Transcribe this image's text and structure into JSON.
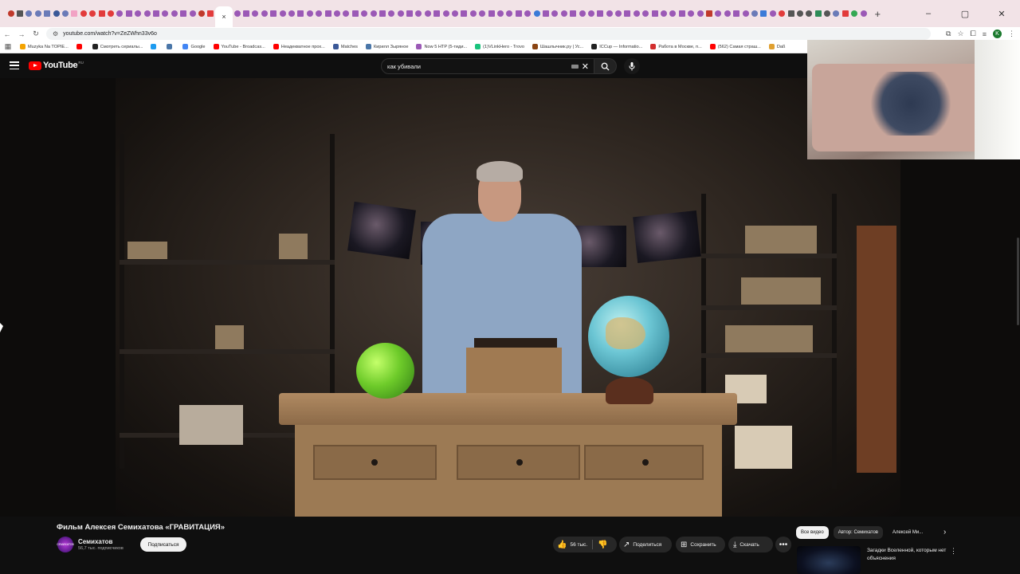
{
  "browser": {
    "tab_favicons": [
      "#c0392b",
      "#555555",
      "#6b7bb8",
      "#6b7bb8",
      "#6b7bb8",
      "#3b5998",
      "#6b7bb8",
      "#f2a2c4",
      "#e23b3b",
      "#e23b3b",
      "#e23b3b",
      "#e23b3b",
      "#9b59b6",
      "#9b59b6",
      "#9b59b6",
      "#9b59b6",
      "#9b59b6",
      "#9b59b6",
      "#9b59b6",
      "#9b59b6",
      "#9b59b6",
      "#c0392b",
      "#e23b3b"
    ],
    "active_tab_close": "×",
    "tab_favicons_after": [
      "#9b59b6",
      "#9b59b6",
      "#9b59b6",
      "#9b59b6",
      "#9b59b6",
      "#9b59b6",
      "#9b59b6",
      "#9b59b6",
      "#9b59b6",
      "#9b59b6",
      "#9b59b6",
      "#9b59b6",
      "#9b59b6",
      "#9b59b6",
      "#9b59b6",
      "#9b59b6",
      "#9b59b6",
      "#9b59b6",
      "#9b59b6",
      "#9b59b6",
      "#9b59b6",
      "#9b59b6",
      "#9b59b6",
      "#9b59b6",
      "#9b59b6",
      "#9b59b6",
      "#9b59b6",
      "#9b59b6",
      "#9b59b6",
      "#9b59b6",
      "#9b59b6",
      "#9b59b6",
      "#9b59b6",
      "#3b7bd8",
      "#9b59b6",
      "#9b59b6",
      "#9b59b6",
      "#9b59b6",
      "#9b59b6",
      "#9b59b6",
      "#9b59b6",
      "#9b59b6",
      "#9b59b6",
      "#9b59b6",
      "#9b59b6",
      "#9b59b6",
      "#9b59b6",
      "#9b59b6",
      "#9b59b6",
      "#9b59b6",
      "#9b59b6",
      "#9b59b6",
      "#c0392b",
      "#9b59b6",
      "#9b59b6",
      "#9b59b6",
      "#9b59b6",
      "#6b7bb8",
      "#3b7bd8",
      "#9b59b6",
      "#e23b3b",
      "#555555",
      "#555555",
      "#555555",
      "#2e8b57",
      "#555555",
      "#6b7bb8",
      "#e23b3b",
      "#34a853",
      "#9b59b6"
    ],
    "new_tab": "+",
    "window_controls": [
      "–",
      "▢",
      "✕"
    ],
    "url": "youtube.com/watch?v=ZeZWhn33v6o",
    "bookmarks": [
      {
        "label": "Muzyka Na TOPIE...",
        "color": "#f4a300"
      },
      {
        "label": "",
        "color": "#ff0000"
      },
      {
        "label": "Смотреть сериалы...",
        "color": "#222222"
      },
      {
        "label": "",
        "color": "#1d9bf0"
      },
      {
        "label": "",
        "color": "#4a76a8"
      },
      {
        "label": "Google",
        "color": "#4285f4"
      },
      {
        "label": "YouTube - Broadcas...",
        "color": "#ff0000"
      },
      {
        "label": "Неадекватное прох...",
        "color": "#ff0000"
      },
      {
        "label": "Matches",
        "color": "#3b5998"
      },
      {
        "label": "Кирилл Зыряное",
        "color": "#4a76a8"
      },
      {
        "label": "Now 5 HTP (5-тиди...",
        "color": "#9b59b6"
      },
      {
        "label": "(1)VLinkHero - Trovo",
        "color": "#19c37d"
      },
      {
        "label": "Шашлычник.ру | Ус...",
        "color": "#8b4513"
      },
      {
        "label": "ICCup — Informatio...",
        "color": "#222222"
      },
      {
        "label": "Работа в Москве, п...",
        "color": "#d32f2f"
      },
      {
        "label": "(562) Самая страш...",
        "color": "#ff0000"
      },
      {
        "label": "Daß",
        "color": "#e0a030"
      }
    ]
  },
  "youtube": {
    "logo_word": "YouTube",
    "logo_region": "RU",
    "search_query": "как убивали",
    "clear": "✕",
    "video_title": "Фильм Алексея Семихатова «ГРАВИТАЦИЯ»",
    "channel_avatar_text": "СЕМИХАТОВ",
    "channel_name": "Семихатов",
    "subscribers": "56,7 тыс. подписчиков",
    "subscribe": "Подписаться",
    "likes": "56 тыс.",
    "share": "Поделиться",
    "save": "Сохранить",
    "download": "Скачать",
    "more": "•••",
    "chips": [
      "Все видео",
      "Автор: Семихатов",
      "Алексей Ми..."
    ],
    "chip_next": "›",
    "recommendation_title": "Загадки Вселенной, которым нет объяснения",
    "rec_more": "⋮"
  }
}
